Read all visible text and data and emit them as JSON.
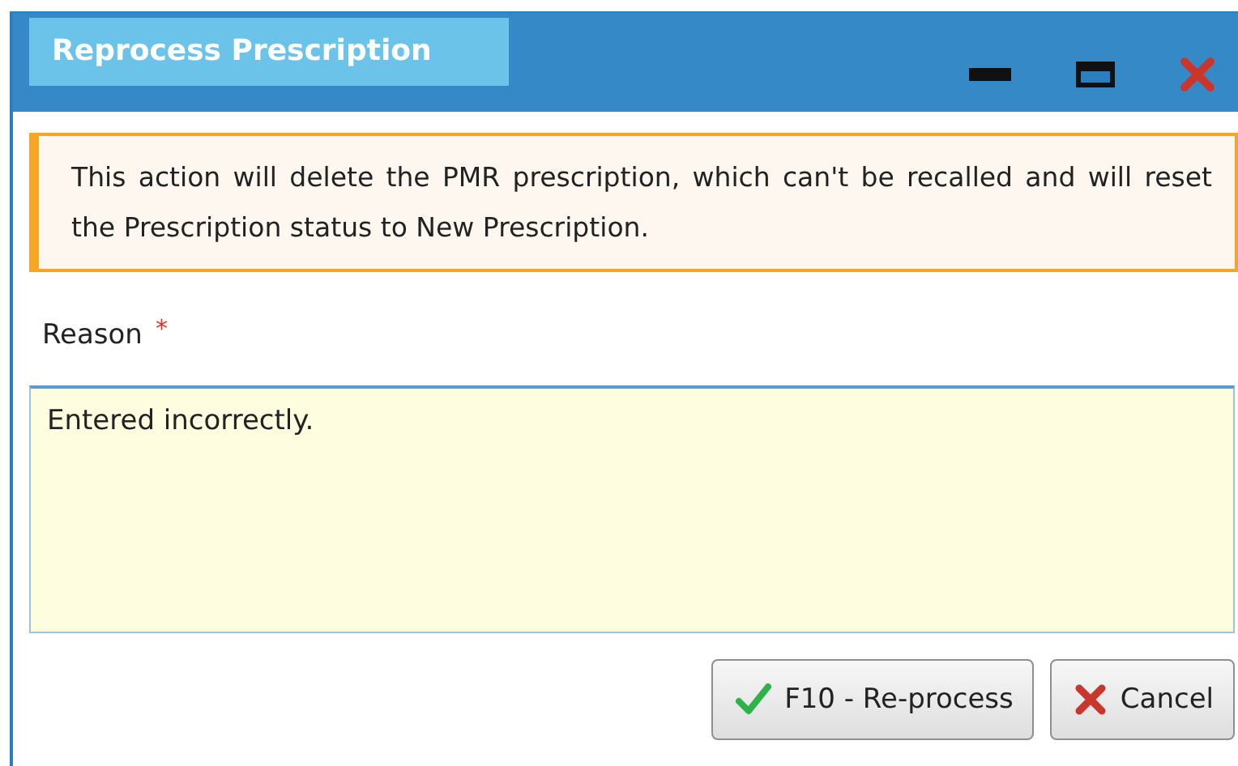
{
  "window": {
    "title": "Reprocess Prescription"
  },
  "notice": {
    "text": "This action will delete the PMR prescription, which can't be recalled and will reset the Prescription status to New Prescription."
  },
  "reason": {
    "label": "Reason",
    "required_mark": "*",
    "value": "Entered incorrectly."
  },
  "buttons": [
    {
      "label": "F10 - Re-process",
      "kind": "confirm"
    },
    {
      "label": "Cancel",
      "kind": "cancel"
    }
  ]
}
